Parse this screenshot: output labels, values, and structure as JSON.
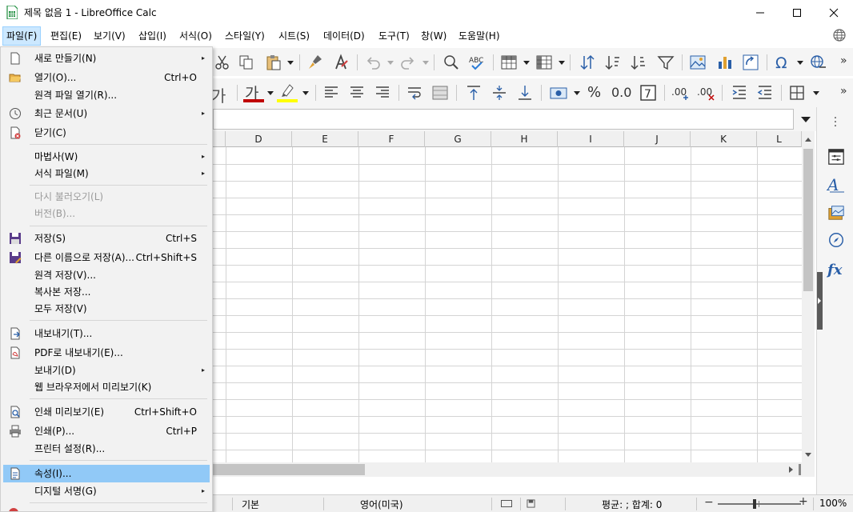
{
  "window": {
    "title": "제목 없음 1 - LibreOffice Calc"
  },
  "menubar": {
    "items": [
      {
        "label": "파일(F)"
      },
      {
        "label": "편집(E)"
      },
      {
        "label": "보기(V)"
      },
      {
        "label": "삽입(I)"
      },
      {
        "label": "서식(O)"
      },
      {
        "label": "스타일(Y)"
      },
      {
        "label": "시트(S)"
      },
      {
        "label": "데이터(D)"
      },
      {
        "label": "도구(T)"
      },
      {
        "label": "창(W)"
      },
      {
        "label": "도움말(H)"
      }
    ]
  },
  "file_menu": {
    "items": [
      {
        "label": "새로 만들기(N)",
        "shortcut": "",
        "submenu": true,
        "icon": "new-document-icon"
      },
      {
        "label": "열기(O)...",
        "shortcut": "Ctrl+O",
        "submenu": false,
        "icon": "open-folder-icon"
      },
      {
        "label": "원격 파일 열기(R)...",
        "shortcut": "",
        "submenu": false,
        "icon": ""
      },
      {
        "label": "최근 문서(U)",
        "shortcut": "",
        "submenu": true,
        "icon": "recent-clock-icon"
      },
      {
        "label": "닫기(C)",
        "shortcut": "",
        "submenu": false,
        "icon": "close-document-icon"
      },
      {
        "label": "마법사(W)",
        "shortcut": "",
        "submenu": true,
        "icon": ""
      },
      {
        "label": "서식 파일(M)",
        "shortcut": "",
        "submenu": true,
        "icon": ""
      },
      {
        "label": "다시 불러오기(L)",
        "shortcut": "",
        "submenu": false,
        "icon": "",
        "disabled": true
      },
      {
        "label": "버전(B)...",
        "shortcut": "",
        "submenu": false,
        "icon": "",
        "disabled": true
      },
      {
        "label": "저장(S)",
        "shortcut": "Ctrl+S",
        "submenu": false,
        "icon": "save-icon"
      },
      {
        "label": "다른 이름으로 저장(A)...",
        "shortcut": "Ctrl+Shift+S",
        "submenu": false,
        "icon": "save-as-icon"
      },
      {
        "label": "원격 저장(V)...",
        "shortcut": "",
        "submenu": false,
        "icon": ""
      },
      {
        "label": "복사본 저장...",
        "shortcut": "",
        "submenu": false,
        "icon": ""
      },
      {
        "label": "모두 저장(V)",
        "shortcut": "",
        "submenu": false,
        "icon": ""
      },
      {
        "label": "내보내기(T)...",
        "shortcut": "",
        "submenu": false,
        "icon": "export-icon"
      },
      {
        "label": "PDF로 내보내기(E)...",
        "shortcut": "",
        "submenu": false,
        "icon": "export-pdf-icon"
      },
      {
        "label": "보내기(D)",
        "shortcut": "",
        "submenu": true,
        "icon": ""
      },
      {
        "label": "웹 브라우저에서 미리보기(K)",
        "shortcut": "",
        "submenu": false,
        "icon": ""
      },
      {
        "label": "인쇄 미리보기(E)",
        "shortcut": "Ctrl+Shift+O",
        "submenu": false,
        "icon": "print-preview-icon"
      },
      {
        "label": "인쇄(P)...",
        "shortcut": "Ctrl+P",
        "submenu": false,
        "icon": "printer-icon"
      },
      {
        "label": "프린터 설정(R)...",
        "shortcut": "",
        "submenu": false,
        "icon": ""
      },
      {
        "label": "속성(I)...",
        "shortcut": "",
        "submenu": false,
        "icon": "properties-icon",
        "highlighted": true
      },
      {
        "label": "디지털 서명(G)",
        "shortcut": "",
        "submenu": true,
        "icon": ""
      }
    ]
  },
  "toolbar": {
    "char_ga": "가",
    "percent": "%",
    "zero_decimal": "0.0"
  },
  "columns": [
    "D",
    "E",
    "F",
    "G",
    "H",
    "I",
    "J",
    "K",
    "L"
  ],
  "statusbar": {
    "page_style": "기본",
    "language": "영어(미국)",
    "summary": "평균: ; 합계: 0",
    "zoom": "100%"
  },
  "colors": {
    "menu_highlight": "#91c9f7",
    "menubar_active": "#cce8ff",
    "calc_green": "#1e8e3e"
  }
}
